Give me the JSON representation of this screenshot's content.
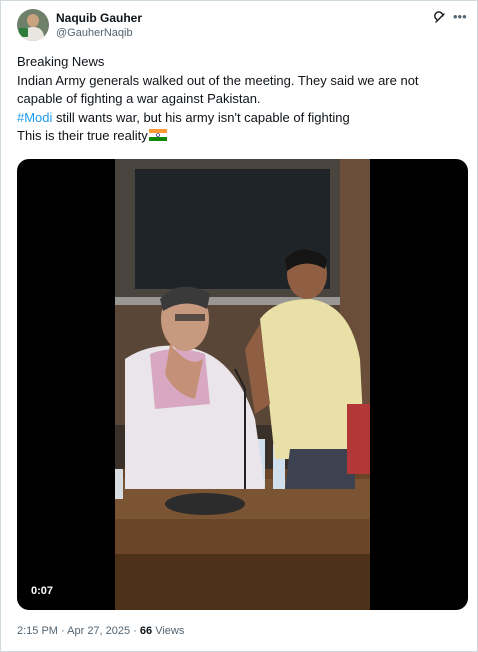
{
  "author": {
    "name": "Naquib Gauher",
    "handle": "@GauherNaqib"
  },
  "icons": {
    "avatar": "profile-avatar",
    "grok": "grok-icon",
    "more": "more-options-icon",
    "flag": "india-flag-emoji"
  },
  "post": {
    "line1": "Breaking News",
    "line2": "Indian Army generals walked out of the meeting. They said  we are not",
    "line3": "capable of fighting a war against Pakistan.",
    "hashtag": "#Modi",
    "line4_rest": " still wants war, but his army isn't capable of fighting",
    "line5": "This is their true reality"
  },
  "video": {
    "timestamp": "0:07"
  },
  "meta": {
    "time": "2:15 PM",
    "separator1": " · ",
    "date": "Apr 27, 2025",
    "separator2": " · ",
    "views_count": "66",
    "views_label": " Views"
  },
  "colors": {
    "link": "#1d9bf0",
    "secondary_text": "#536471",
    "border": "#cfd9de"
  }
}
